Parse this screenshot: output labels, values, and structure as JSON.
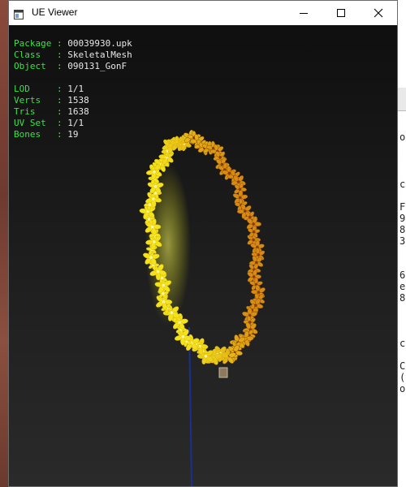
{
  "window": {
    "title": "UE Viewer"
  },
  "info": {
    "package_label": "Package : ",
    "package_value": "00039930.upk",
    "class_label": "Class   : ",
    "class_value": "SkeletalMesh",
    "object_label": "Object  : ",
    "object_value": "090131_GonF",
    "lod_label": "LOD     : ",
    "lod_value": "1/1",
    "verts_label": "Verts   : ",
    "verts_value": "1538",
    "tris_label": "Tris    : ",
    "tris_value": "1638",
    "uvset_label": "UV Set  : ",
    "uvset_value": "1/1",
    "bones_label": "Bones   : ",
    "bones_value": "19"
  },
  "background_window": {
    "fragments": [
      "o",
      "c",
      "F",
      "9",
      "8",
      "3",
      "6",
      "e",
      "8",
      "c",
      "C",
      "(",
      "o"
    ]
  },
  "colors": {
    "label_green": "#3ee04a",
    "value_white": "#e8e8e8",
    "flower_yellow": "#f5e21a",
    "flower_orange": "#d98a12",
    "axis_blue": "#1a2f8f"
  },
  "icons": {
    "app": "app-window-icon",
    "minimize": "minimize-icon",
    "maximize": "maximize-icon",
    "close": "close-icon"
  }
}
